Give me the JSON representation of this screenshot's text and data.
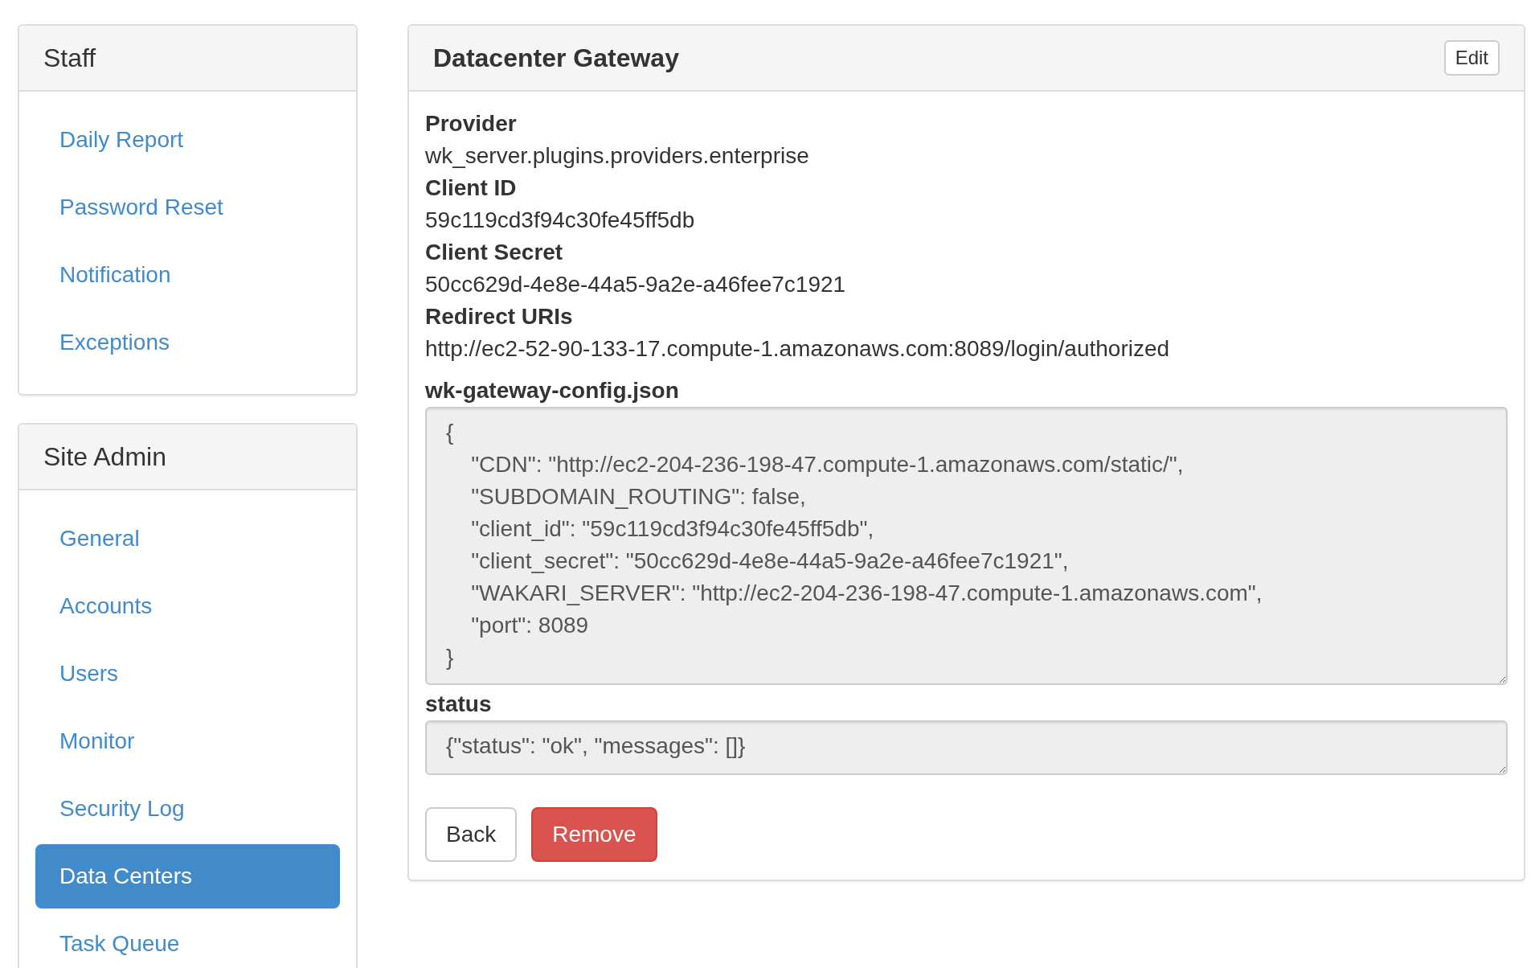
{
  "sidebar": [
    {
      "title": "Staff",
      "items": [
        {
          "label": "Daily Report",
          "selected": false
        },
        {
          "label": "Password Reset",
          "selected": false
        },
        {
          "label": "Notification",
          "selected": false
        },
        {
          "label": "Exceptions",
          "selected": false
        }
      ]
    },
    {
      "title": "Site Admin",
      "items": [
        {
          "label": "General",
          "selected": false
        },
        {
          "label": "Accounts",
          "selected": false
        },
        {
          "label": "Users",
          "selected": false
        },
        {
          "label": "Monitor",
          "selected": false
        },
        {
          "label": "Security Log",
          "selected": false
        },
        {
          "label": "Data Centers",
          "selected": true
        },
        {
          "label": "Task Queue",
          "selected": false
        }
      ]
    }
  ],
  "panel": {
    "title": "Datacenter Gateway",
    "edit_button": "Edit",
    "fields": [
      {
        "label": "Provider",
        "value": "wk_server.plugins.providers.enterprise"
      },
      {
        "label": "Client ID",
        "value": "59c119cd3f94c30fe45ff5db"
      },
      {
        "label": "Client Secret",
        "value": "50cc629d-4e8e-44a5-9a2e-a46fee7c1921"
      },
      {
        "label": "Redirect URIs",
        "value": "http://ec2-52-90-133-17.compute-1.amazonaws.com:8089/login/authorized"
      }
    ],
    "config_label": "wk-gateway-config.json",
    "config_value": "{\n    \"CDN\": \"http://ec2-204-236-198-47.compute-1.amazonaws.com/static/\",\n    \"SUBDOMAIN_ROUTING\": false,\n    \"client_id\": \"59c119cd3f94c30fe45ff5db\",\n    \"client_secret\": \"50cc629d-4e8e-44a5-9a2e-a46fee7c1921\",\n    \"WAKARI_SERVER\": \"http://ec2-204-236-198-47.compute-1.amazonaws.com\",\n    \"port\": 8089\n}",
    "status_label": "status",
    "status_value": "{\"status\": \"ok\", \"messages\": []}",
    "buttons": [
      "Back",
      "Remove"
    ]
  }
}
